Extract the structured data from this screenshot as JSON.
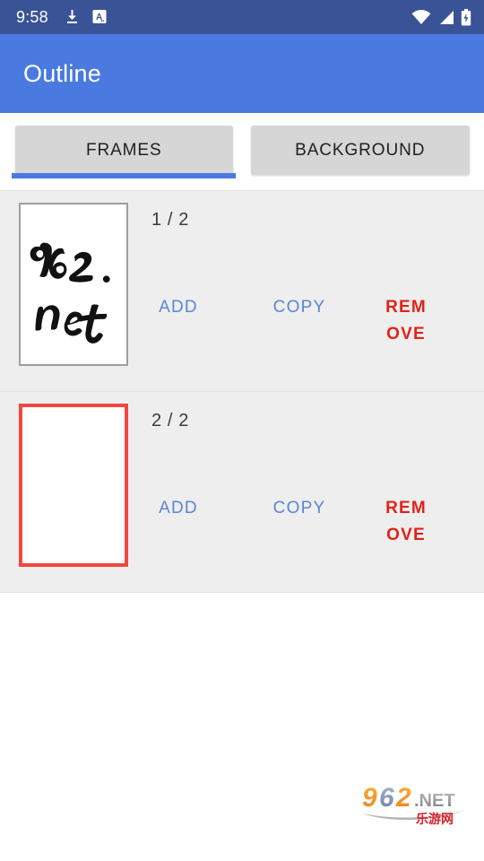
{
  "status_bar": {
    "time": "9:58",
    "left_icons": [
      "download-icon",
      "translate-icon"
    ],
    "right_icons": [
      "wifi-icon",
      "cellular-signal-icon",
      "battery-charging-icon"
    ],
    "background_color": "#3a5396"
  },
  "app_bar": {
    "title": "Outline",
    "background_color": "#4a7ae0",
    "title_color": "#ffffff"
  },
  "tabs": {
    "items": [
      {
        "label": "FRAMES",
        "selected": true
      },
      {
        "label": "BACKGROUND",
        "selected": false
      }
    ],
    "indicator_color": "#4a7ae0",
    "tab_background_color": "#d6d6d6"
  },
  "frames": {
    "rows": [
      {
        "counter": "1 / 2",
        "selected": false,
        "thumbnail": "handwritten-962-net",
        "thumbnail_text_line1": "962 .",
        "thumbnail_text_line2": "net",
        "actions": {
          "add": "ADD",
          "copy": "COPY",
          "remove": "REMOVE"
        }
      },
      {
        "counter": "2 / 2",
        "selected": true,
        "thumbnail": "blank-page",
        "thumbnail_text_line1": "",
        "thumbnail_text_line2": "",
        "actions": {
          "add": "ADD",
          "copy": "COPY",
          "remove": "REMOVE"
        }
      }
    ],
    "action_colors": {
      "add": "#5c85d6",
      "copy": "#5c85d6",
      "remove": "#e32119"
    },
    "selected_border_color": "#f0483f",
    "list_background_color": "#eeeeee"
  },
  "watermark": {
    "digits": "962",
    "suffix": ".NET",
    "chinese": "乐游网",
    "colors": {
      "digit_orange": "#f5861f",
      "digit_blue": "#7b8fb5",
      "suffix_gray": "#8a8a8a",
      "chinese_red": "#d8202a"
    }
  }
}
